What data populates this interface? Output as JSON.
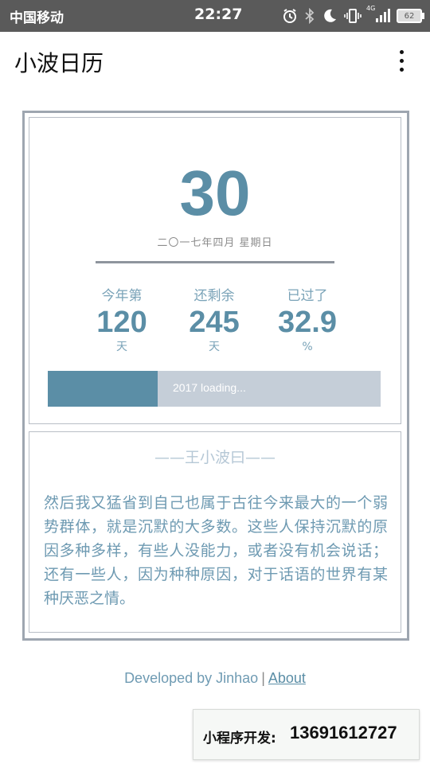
{
  "status_bar": {
    "carrier": "中国移动",
    "time": "22:27",
    "network": "4G",
    "battery": "62",
    "icons": [
      "alarm-icon",
      "bluetooth-icon",
      "moon-icon",
      "vibrate-icon",
      "signal-icon",
      "battery-icon"
    ]
  },
  "app_bar": {
    "title": "小波日历",
    "menu_icon": "more-vert-icon"
  },
  "calendar": {
    "day": "30",
    "date_text": "二〇一七年四月 星期日",
    "stats": [
      {
        "label": "今年第",
        "value": "120",
        "unit": "天"
      },
      {
        "label": "还剩余",
        "value": "245",
        "unit": "天"
      },
      {
        "label": "已过了",
        "value": "32.9",
        "unit": "%"
      }
    ],
    "progress": {
      "text": "2017 loading...",
      "percent": 32.9
    }
  },
  "quote": {
    "author": "——王小波曰——",
    "text": "然后我又猛省到自己也属于古往今来最大的一个弱势群体，就是沉默的大多数。这些人保持沉默的原因多种多样，有些人没能力，或者没有机会说话；还有一些人，因为种种原因，对于话语的世界有某种厌恶之情。"
  },
  "footer": {
    "developer": "Developed by Jinhao",
    "separator": "|",
    "about": "About"
  },
  "promo": {
    "label": "小程序开发:",
    "phone": "13691612727"
  },
  "colors": {
    "accent": "#5b8ea6",
    "track": "#c5ced8",
    "frame": "#9ea6b0",
    "status_bar": "#5a5a5a"
  }
}
